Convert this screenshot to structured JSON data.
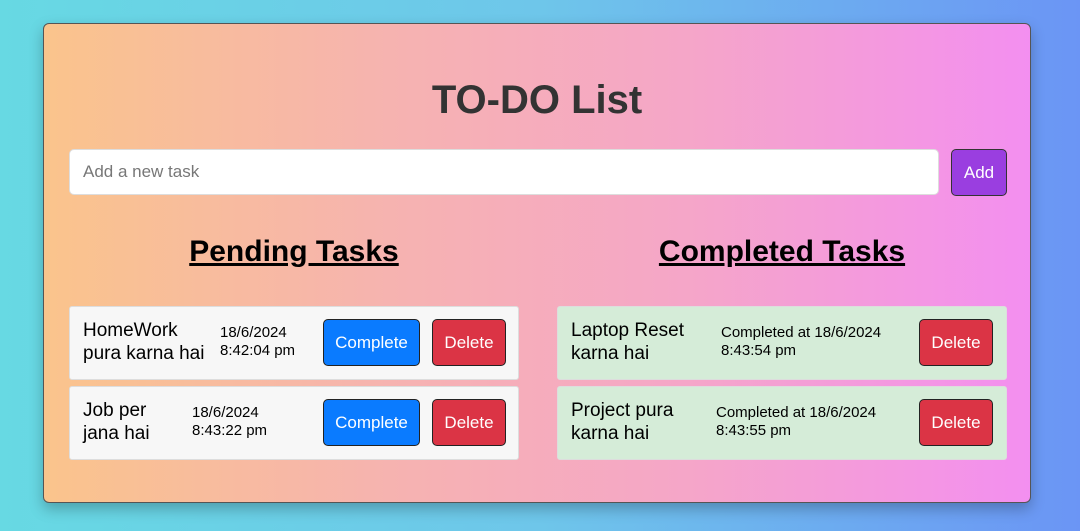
{
  "app": {
    "title": "TO-DO List"
  },
  "input": {
    "placeholder": "Add a new task",
    "value": ""
  },
  "add_button": {
    "label": "Add"
  },
  "pending": {
    "heading": "Pending Tasks",
    "items": [
      {
        "text_line1": "HomeWork",
        "text_line2": "pura karna hai",
        "date": "18/6/2024",
        "time": "8:42:04 pm",
        "complete_label": "Complete",
        "delete_label": "Delete"
      },
      {
        "text_line1": "Job per",
        "text_line2": "jana hai",
        "date": "18/6/2024",
        "time": "8:43:22 pm",
        "complete_label": "Complete",
        "delete_label": "Delete"
      }
    ]
  },
  "completed": {
    "heading": "Completed Tasks",
    "items": [
      {
        "text_line1": "Laptop Reset",
        "text_line2": "karna hai",
        "completed_line1": "Completed at 18/6/2024",
        "completed_line2": "8:43:54 pm",
        "delete_label": "Delete"
      },
      {
        "text_line1": "Project pura",
        "text_line2": "karna hai",
        "completed_line1": "Completed at 18/6/2024",
        "completed_line2": "8:43:55 pm",
        "delete_label": "Delete"
      }
    ]
  },
  "colors": {
    "add_button": "#9a3ee0",
    "complete_button": "#0a7bff",
    "delete_button": "#db3445",
    "completed_item_bg": "#d5ecd8",
    "pending_item_bg": "#f7f7f7"
  }
}
